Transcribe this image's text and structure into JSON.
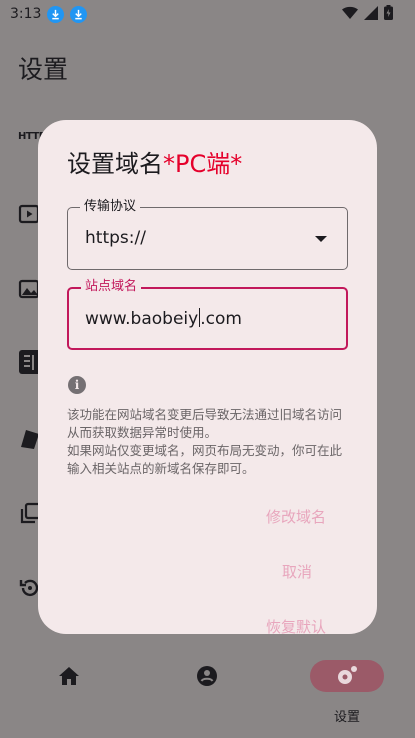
{
  "status_bar": {
    "time": "3:13"
  },
  "background": {
    "page_title": "设置",
    "http_icon_text": "HTTP"
  },
  "bottom_nav": {
    "items": [
      {
        "name": "home"
      },
      {
        "name": "location"
      },
      {
        "name": "settings",
        "label": "设置",
        "active": true
      }
    ]
  },
  "dialog": {
    "title": "设置域名",
    "title_accent": "*PC端*",
    "protocol": {
      "label": "传输协议",
      "value": "https://"
    },
    "domain": {
      "label": "站点域名",
      "value_before_cursor": "www.baobeiy",
      "value_after_cursor": ".com"
    },
    "info_text": "该功能在网站域名变更后导致无法通过旧域名访问从而获取数据异常时使用。\n如果网站仅变更域名，网页布局无变动，你可在此输入相关站点的新域名保存即可。",
    "buttons": {
      "modify": "修改域名",
      "cancel": "取消",
      "restore": "恢复默认"
    }
  },
  "colors": {
    "accent": "#c2185b",
    "title_accent": "#e5002b",
    "button_text": "#e8a6bd",
    "dialog_bg": "#f4e9ea",
    "nav_active": "#9b5a68"
  }
}
